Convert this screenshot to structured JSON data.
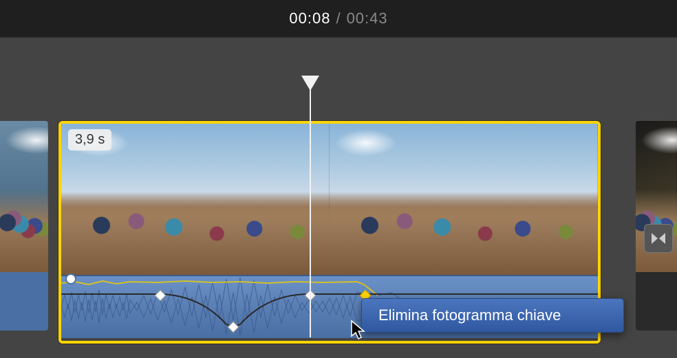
{
  "timecode": {
    "current": "00:08",
    "separator": "/",
    "total": "00:43"
  },
  "clip": {
    "duration_label": "3,9 s"
  },
  "context_menu": {
    "items": [
      {
        "label": "Elimina fotogramma chiave"
      }
    ]
  },
  "colors": {
    "selection": "#ffd400",
    "menu_bg": "#3a62ab",
    "waveform": "#5a7fb5"
  }
}
